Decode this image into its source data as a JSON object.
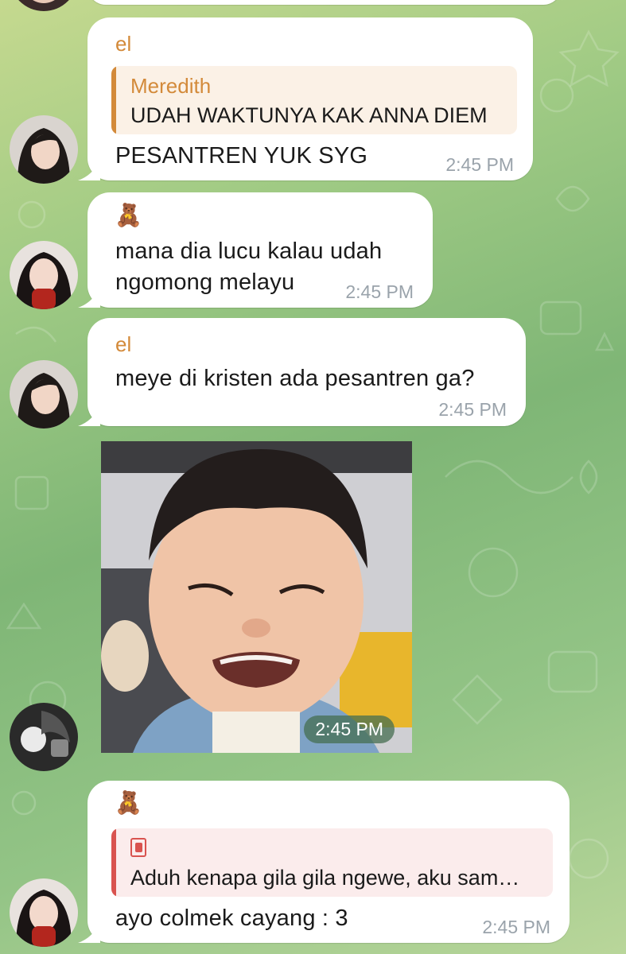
{
  "messages": [
    {
      "sender": "el",
      "reply": {
        "name": "Meredith",
        "text": "UDAH WAKTUNYA KAK ANNA DIEM"
      },
      "text": "PESANTREN YUK SYG",
      "time": "2:45 PM"
    },
    {
      "sender_icon": "teddy-bear-icon",
      "sender_emoji": "🧸",
      "text_lines": [
        "mana dia lucu kalau udah",
        "ngomong melayu"
      ],
      "time": "2:45 PM"
    },
    {
      "sender": "el",
      "text": "meye di kristen ada pesantren ga?",
      "time": "2:45 PM"
    },
    {
      "type": "photo",
      "photo_icon": "crying-toddler-photo",
      "time": "2:45 PM"
    },
    {
      "sender_icon": "teddy-bear-icon",
      "sender_emoji": "🧸",
      "reply": {
        "name_icon": "red-sticker-icon",
        "text": "Aduh kenapa gila gila ngewe, aku sam…"
      },
      "text": "ayo colmek cayang : 3",
      "time": "2:45 PM"
    }
  ],
  "colors": {
    "sender_orange": "#d38a3a",
    "reply_orange_bar": "#d38a3a",
    "reply_orange_bg": "#fbf1e6",
    "reply_red_bar": "#d9534f",
    "reply_red_bg": "#fbecec",
    "time_gray": "#9aa3ab"
  }
}
